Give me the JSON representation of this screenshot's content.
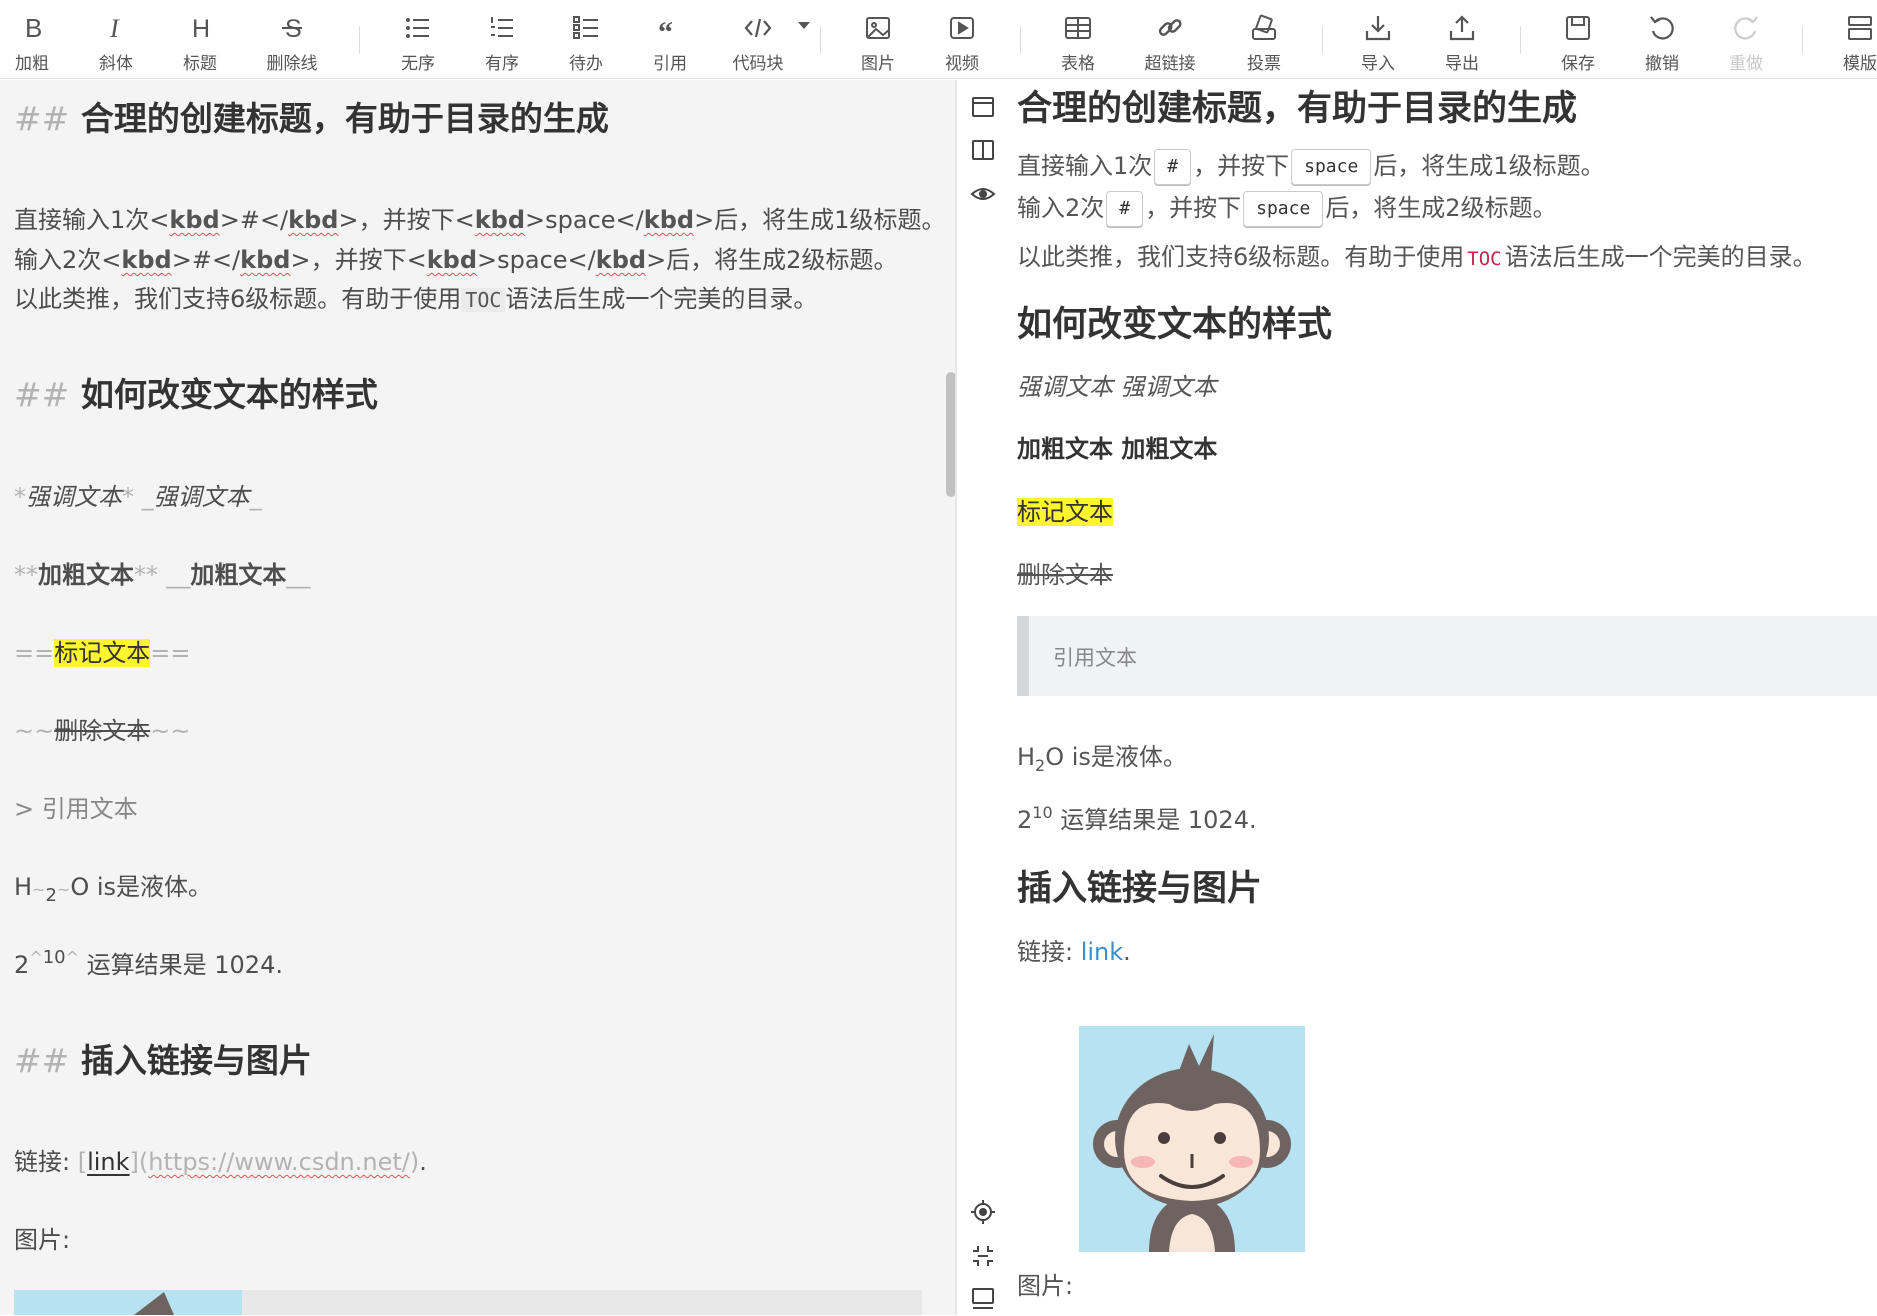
{
  "toolbar": {
    "items": [
      {
        "label": "加粗",
        "icon": "bold-icon"
      },
      {
        "label": "斜体",
        "icon": "italic-icon"
      },
      {
        "label": "标题",
        "icon": "heading-icon"
      },
      {
        "label": "删除线",
        "icon": "strikethrough-icon"
      },
      {
        "label": "无序",
        "icon": "unordered-list-icon"
      },
      {
        "label": "有序",
        "icon": "ordered-list-icon"
      },
      {
        "label": "待办",
        "icon": "todo-list-icon"
      },
      {
        "label": "引用",
        "icon": "quote-icon"
      },
      {
        "label": "代码块",
        "icon": "code-block-icon"
      },
      {
        "label": "图片",
        "icon": "image-icon"
      },
      {
        "label": "视频",
        "icon": "video-icon"
      },
      {
        "label": "表格",
        "icon": "table-icon"
      },
      {
        "label": "超链接",
        "icon": "link-icon"
      },
      {
        "label": "投票",
        "icon": "vote-icon"
      },
      {
        "label": "导入",
        "icon": "import-icon"
      },
      {
        "label": "导出",
        "icon": "export-icon"
      },
      {
        "label": "保存",
        "icon": "save-icon"
      },
      {
        "label": "撤销",
        "icon": "undo-icon"
      },
      {
        "label": "重做",
        "icon": "redo-icon",
        "disabled": true
      },
      {
        "label": "模版",
        "icon": "template-icon"
      }
    ]
  },
  "editor": {
    "h1_mark": "##",
    "h1_text": "合理的创建标题，有助于目录的生成",
    "l1": {
      "a": "直接输入1次<",
      "kbd1": "kbd",
      "b": ">#</",
      "kbd2": "kbd",
      "c": ">，并按下<",
      "kbd3": "kbd",
      "d": ">space</",
      "kbd4": "kbd",
      "e": ">后，将生成1级标题。"
    },
    "l2": {
      "a": "输入2次<",
      "kbd1": "kbd",
      "b": ">#</",
      "kbd2": "kbd",
      "c": ">，并按下<",
      "kbd3": "kbd",
      "d": ">space</",
      "kbd4": "kbd",
      "e": ">后，将生成2级标题。"
    },
    "l3": {
      "a": "以此类推，我们支持6级标题。有助于使用",
      "code": "TOC",
      "b": "语法后生成一个完美的目录。"
    },
    "h2_mark": "##",
    "h2_text": "如何改变文本的样式",
    "italic": {
      "m1": "*",
      "t1": "强调文本",
      "m2": "*",
      "m3": "_",
      "t2": "强调文本",
      "m4": "_"
    },
    "bold": {
      "m1": "**",
      "t1": "加粗文本",
      "m2": "**",
      "m3": "__",
      "t2": "加粗文本",
      "m4": "__"
    },
    "mark": {
      "m1": "==",
      "t": "标记文本",
      "m2": "=="
    },
    "strike": {
      "m1": "~~",
      "t": "删除文本",
      "m2": "~~"
    },
    "quote": {
      "m": ">",
      "t": "引用文本"
    },
    "sub": {
      "a": "H",
      "m1": "~",
      "n": "2",
      "m2": "~",
      "b": "O is是液体。"
    },
    "sup": {
      "a": "2",
      "m1": "^",
      "n": "10",
      "m2": "^",
      "b": " 运算结果是 1024."
    },
    "h3_mark": "##",
    "h3_text": "插入链接与图片",
    "link": {
      "a": "链接: ",
      "b1": "[",
      "text": "link",
      "b2": "](",
      "url": "https://www.csdn.net/",
      "b3": ")",
      "c": "."
    },
    "img_label": "图片:"
  },
  "sidebar": {
    "icons": [
      "layout-top-icon",
      "split-view-icon",
      "preview-eye-icon",
      "locate-icon",
      "fit-icon",
      "monitor-icon"
    ]
  },
  "preview": {
    "h1": "合理的创建标题，有助于目录的生成",
    "p1": {
      "a": "直接输入1次",
      "k1": "#",
      "b": "，并按下",
      "k2": "space",
      "c": "后，将生成1级标题。"
    },
    "p2": {
      "a": "输入2次",
      "k1": "#",
      "b": "，并按下",
      "k2": "space",
      "c": "后，将生成2级标题。"
    },
    "p3": {
      "a": "以此类推，我们支持6级标题。有助于使用",
      "toc": "TOC",
      "b": "语法后生成一个完美的目录。"
    },
    "h2": "如何改变文本的样式",
    "italic": "强调文本 强调文本",
    "bold": "加粗文本 加粗文本",
    "mark": "标记文本",
    "strike": "删除文本",
    "quote": "引用文本",
    "sub": {
      "a": "H",
      "n": "2",
      "b": "O is是液体。"
    },
    "sup": {
      "a": "2",
      "n": "10",
      "b": " 运算结果是 1024."
    },
    "h3": "插入链接与图片",
    "link": {
      "a": "链接: ",
      "text": "link",
      "b": "."
    },
    "img_label": "图片:"
  },
  "colors": {
    "highlight": "#fff52e",
    "link": "#3a8fcf",
    "toc": "#c7254e",
    "image_bg": "#b7e2f2"
  }
}
